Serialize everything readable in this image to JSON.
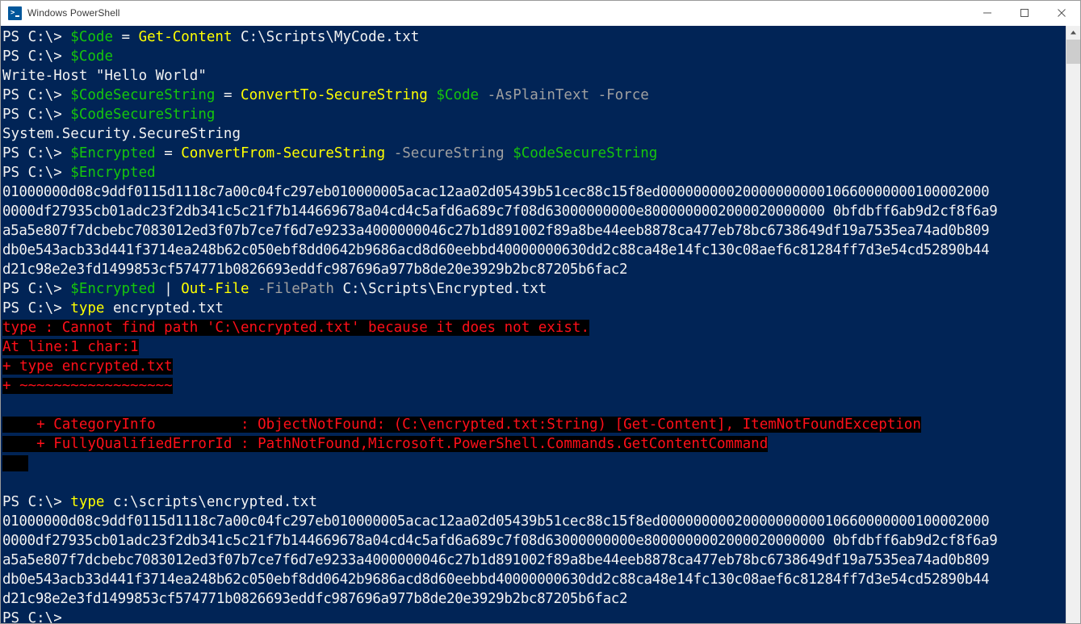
{
  "window": {
    "title": "Windows PowerShell",
    "icon": "powershell-icon",
    "minimize_label": "—",
    "maximize_label": "□",
    "close_label": "✕",
    "background_color": "#012456",
    "error_background_color": "#000000",
    "error_text_color": "#ff0f19",
    "prompt_color": "#f2f2f2",
    "variable_color": "#16c60c",
    "cmdlet_color": "#ffff00",
    "parameter_color": "#a0a0a0"
  },
  "scrollbar": {
    "up_arrow": "▲",
    "thumb_position": "top"
  },
  "console": {
    "prompt": "PS C:\\> ",
    "lines": [
      {
        "id": "cmd-1",
        "type": "command",
        "parts": [
          {
            "text": "PS C:\\> ",
            "color": "white"
          },
          {
            "text": "$Code",
            "color": "green"
          },
          {
            "text": " = ",
            "color": "white"
          },
          {
            "text": "Get-Content",
            "color": "yellow"
          },
          {
            "text": " C:\\Scripts\\MyCode.txt",
            "color": "white"
          }
        ]
      },
      {
        "id": "cmd-2",
        "type": "command",
        "parts": [
          {
            "text": "PS C:\\> ",
            "color": "white"
          },
          {
            "text": "$Code",
            "color": "green"
          }
        ]
      },
      {
        "id": "out-1",
        "type": "output",
        "parts": [
          {
            "text": "Write-Host \"Hello World\"",
            "color": "white"
          }
        ]
      },
      {
        "id": "cmd-3",
        "type": "command",
        "parts": [
          {
            "text": "PS C:\\> ",
            "color": "white"
          },
          {
            "text": "$CodeSecureString",
            "color": "green"
          },
          {
            "text": " = ",
            "color": "white"
          },
          {
            "text": "ConvertTo-SecureString",
            "color": "yellow"
          },
          {
            "text": " ",
            "color": "white"
          },
          {
            "text": "$Code",
            "color": "green"
          },
          {
            "text": " ",
            "color": "white"
          },
          {
            "text": "-AsPlainText -Force",
            "color": "gray"
          }
        ]
      },
      {
        "id": "cmd-4",
        "type": "command",
        "parts": [
          {
            "text": "PS C:\\> ",
            "color": "white"
          },
          {
            "text": "$CodeSecureString",
            "color": "green"
          }
        ]
      },
      {
        "id": "out-2",
        "type": "output",
        "parts": [
          {
            "text": "System.Security.SecureString",
            "color": "white"
          }
        ]
      },
      {
        "id": "cmd-5",
        "type": "command",
        "parts": [
          {
            "text": "PS C:\\> ",
            "color": "white"
          },
          {
            "text": "$Encrypted",
            "color": "green"
          },
          {
            "text": " = ",
            "color": "white"
          },
          {
            "text": "ConvertFrom-SecureString",
            "color": "yellow"
          },
          {
            "text": " ",
            "color": "white"
          },
          {
            "text": "-SecureString",
            "color": "gray"
          },
          {
            "text": " ",
            "color": "white"
          },
          {
            "text": "$CodeSecureString",
            "color": "green"
          }
        ]
      },
      {
        "id": "cmd-6",
        "type": "command",
        "parts": [
          {
            "text": "PS C:\\> ",
            "color": "white"
          },
          {
            "text": "$Encrypted",
            "color": "green"
          }
        ]
      },
      {
        "id": "hex-1-1",
        "type": "hex",
        "parts": [
          {
            "text": "01000000d08c9ddf0115d1118c7a00c04fc297eb010000005acac12aa02d05439b51cec88c15f8ed0000000002000000000010660000000100002000",
            "color": "white"
          }
        ]
      },
      {
        "id": "hex-1-2",
        "type": "hex",
        "parts": [
          {
            "text": "0000df27935cb01adc23f2db341c5c21f7b144669678a04cd4c5afd6a689c7f08d63000000000e8000000002000020000000 0bfdbff6ab9d2cf8f6a9",
            "color": "white"
          }
        ]
      },
      {
        "id": "hex-1-3",
        "type": "hex",
        "parts": [
          {
            "text": "a5a5e807f7dcbebc7083012ed3f07b7ce7f6d7e9233a4000000046c27b1d891002f89a8be44eeb8878ca477eb78bc6738649df19a7535ea74ad0b809",
            "color": "white"
          }
        ]
      },
      {
        "id": "hex-1-4",
        "type": "hex",
        "parts": [
          {
            "text": "db0e543acb33d441f3714ea248b62c050ebf8dd0642b9686acd8d60eebbd40000000630dd2c88ca48e14fc130c08aef6c81284ff7d3e54cd52890b44",
            "color": "white"
          }
        ]
      },
      {
        "id": "hex-1-5",
        "type": "hex",
        "parts": [
          {
            "text": "d21c98e2e3fd1499853cf574771b0826693eddfc987696a977b8de20e3929b2bc87205b6fac2",
            "color": "white"
          }
        ]
      },
      {
        "id": "cmd-7",
        "type": "command",
        "parts": [
          {
            "text": "PS C:\\> ",
            "color": "white"
          },
          {
            "text": "$Encrypted",
            "color": "green"
          },
          {
            "text": " | ",
            "color": "white"
          },
          {
            "text": "Out-File",
            "color": "yellow"
          },
          {
            "text": " ",
            "color": "white"
          },
          {
            "text": "-FilePath",
            "color": "gray"
          },
          {
            "text": " C:\\Scripts\\Encrypted.txt",
            "color": "white"
          }
        ]
      },
      {
        "id": "cmd-8",
        "type": "command",
        "parts": [
          {
            "text": "PS C:\\> ",
            "color": "white"
          },
          {
            "text": "type",
            "color": "yellow"
          },
          {
            "text": " encrypted.txt",
            "color": "white"
          }
        ]
      },
      {
        "id": "err-1",
        "type": "error",
        "text": "type : Cannot find path 'C:\\encrypted.txt' because it does not exist."
      },
      {
        "id": "err-2",
        "type": "error",
        "text": "At line:1 char:1"
      },
      {
        "id": "err-3",
        "type": "error",
        "text": "+ type encrypted.txt"
      },
      {
        "id": "err-4",
        "type": "error",
        "text": "+ ~~~~~~~~~~~~~~~~~~"
      },
      {
        "id": "err-5",
        "type": "error",
        "text": ""
      },
      {
        "id": "err-6",
        "type": "error",
        "text": "    + CategoryInfo          : ObjectNotFound: (C:\\encrypted.txt:String) [Get-Content], ItemNotFoundException"
      },
      {
        "id": "err-7",
        "type": "error",
        "text": "    + FullyQualifiedErrorId : PathNotFound,Microsoft.PowerShell.Commands.GetContentCommand"
      },
      {
        "id": "err-8",
        "type": "error",
        "text": "   "
      },
      {
        "id": "blank-1",
        "type": "blank",
        "text": " "
      },
      {
        "id": "cmd-9",
        "type": "command",
        "parts": [
          {
            "text": "PS C:\\> ",
            "color": "white"
          },
          {
            "text": "type",
            "color": "yellow"
          },
          {
            "text": " c:\\scripts\\encrypted.txt",
            "color": "white"
          }
        ]
      },
      {
        "id": "hex-2-1",
        "type": "hex",
        "parts": [
          {
            "text": "01000000d08c9ddf0115d1118c7a00c04fc297eb010000005acac12aa02d05439b51cec88c15f8ed0000000002000000000010660000000100002000",
            "color": "white"
          }
        ]
      },
      {
        "id": "hex-2-2",
        "type": "hex",
        "parts": [
          {
            "text": "0000df27935cb01adc23f2db341c5c21f7b144669678a04cd4c5afd6a689c7f08d63000000000e8000000002000020000000 0bfdbff6ab9d2cf8f6a9",
            "color": "white"
          }
        ]
      },
      {
        "id": "hex-2-3",
        "type": "hex",
        "parts": [
          {
            "text": "a5a5e807f7dcbebc7083012ed3f07b7ce7f6d7e9233a4000000046c27b1d891002f89a8be44eeb8878ca477eb78bc6738649df19a7535ea74ad0b809",
            "color": "white"
          }
        ]
      },
      {
        "id": "hex-2-4",
        "type": "hex",
        "parts": [
          {
            "text": "db0e543acb33d441f3714ea248b62c050ebf8dd0642b9686acd8d60eebbd40000000630dd2c88ca48e14fc130c08aef6c81284ff7d3e54cd52890b44",
            "color": "white"
          }
        ]
      },
      {
        "id": "hex-2-5",
        "type": "hex",
        "parts": [
          {
            "text": "d21c98e2e3fd1499853cf574771b0826693eddfc987696a977b8de20e3929b2bc87205b6fac2",
            "color": "white"
          }
        ]
      },
      {
        "id": "cmd-10",
        "type": "command",
        "parts": [
          {
            "text": "PS C:\\>",
            "color": "white"
          }
        ]
      }
    ]
  }
}
